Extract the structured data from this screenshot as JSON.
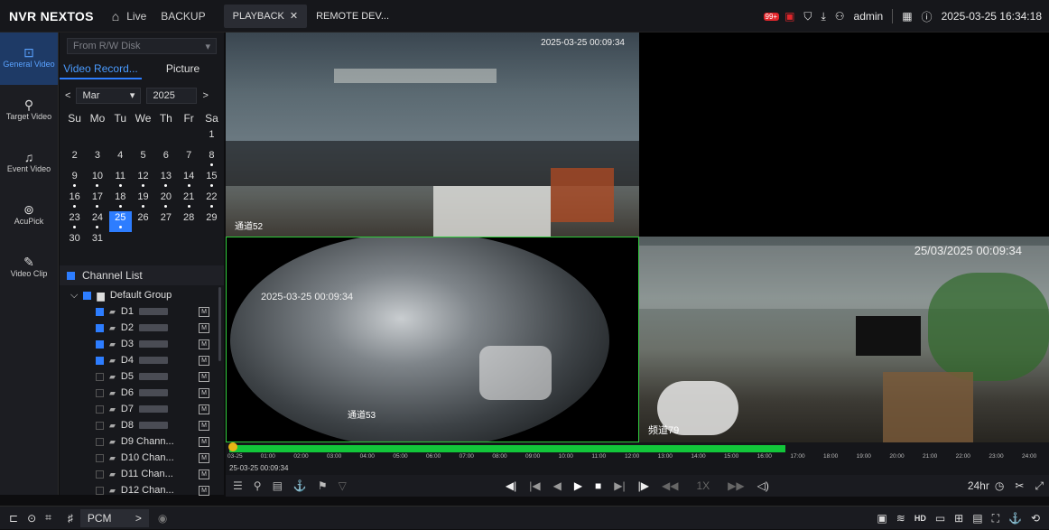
{
  "header": {
    "logo": "NVR NEXTOS",
    "live": "Live",
    "backup": "BACKUP",
    "tabs": [
      {
        "label": "PLAYBACK"
      },
      {
        "label": "REMOTE DEV..."
      }
    ],
    "notif_count": "99+",
    "user": "admin",
    "datetime": "2025-03-25 16:34:18"
  },
  "leftnav": [
    {
      "label": "General Video",
      "icon": "play-box-icon"
    },
    {
      "label": "Target Video",
      "icon": "target-person-icon"
    },
    {
      "label": "Event Video",
      "icon": "bell-icon"
    },
    {
      "label": "AcuPick",
      "icon": "search-person-icon"
    },
    {
      "label": "Video Clip",
      "icon": "edit-box-icon"
    }
  ],
  "panel": {
    "source": "From R/W Disk",
    "tabs": [
      "Video Record...",
      "Picture"
    ],
    "month": "Mar",
    "year": "2025",
    "weekdays": [
      "Su",
      "Mo",
      "Tu",
      "We",
      "Th",
      "Fr",
      "Sa"
    ],
    "selected_day": "25",
    "channel_list_title": "Channel List",
    "group": "Default Group",
    "channels": [
      {
        "label": "D1",
        "checked": true
      },
      {
        "label": "D2",
        "checked": true
      },
      {
        "label": "D3",
        "checked": true
      },
      {
        "label": "D4",
        "checked": true
      },
      {
        "label": "D5",
        "checked": false
      },
      {
        "label": "D6",
        "checked": false
      },
      {
        "label": "D7",
        "checked": false
      },
      {
        "label": "D8",
        "checked": false
      },
      {
        "label": "D9 Chann...",
        "checked": false
      },
      {
        "label": "D10 Chan...",
        "checked": false
      },
      {
        "label": "D11 Chan...",
        "checked": false
      },
      {
        "label": "D12 Chan...",
        "checked": false
      }
    ]
  },
  "videos": {
    "v1": {
      "stamp": "2025-03-25 00:09:34",
      "name": "通道52"
    },
    "v2": {
      "stamp": "2025-03-25 00:09:34",
      "name": "通道53"
    },
    "v3": {
      "stamp": "25/03/2025 00:09:34",
      "name": "频道79"
    }
  },
  "timeline": {
    "ticks": [
      "03-25",
      "01:00",
      "02:00",
      "03:00",
      "04:00",
      "05:00",
      "06:00",
      "07:00",
      "08:00",
      "09:00",
      "10:00",
      "11:00",
      "12:00",
      "13:00",
      "14:00",
      "15:00",
      "16:00",
      "17:00",
      "18:00",
      "19:00",
      "20:00",
      "21:00",
      "22:00",
      "23:00",
      "24:00"
    ],
    "current": "25-03-25 00:09:34",
    "speed": "1X",
    "range": "24hr"
  },
  "bottom": {
    "audio": "PCM"
  }
}
